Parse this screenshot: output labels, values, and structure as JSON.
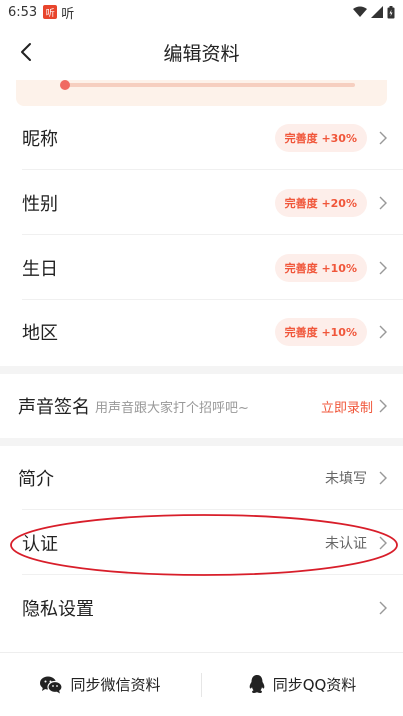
{
  "status_bar": {
    "time": "6:53",
    "app_icon_glyph": "听",
    "app_label": "听"
  },
  "header": {
    "title": "编辑资料"
  },
  "profile_completion": {
    "level": 0.0,
    "accent_color": "#f06a62"
  },
  "rows": [
    {
      "label": "昵称",
      "badge": "完善度 +30%"
    },
    {
      "label": "性别",
      "badge": "完善度 +20%"
    },
    {
      "label": "生日",
      "badge": "完善度 +10%"
    },
    {
      "label": "地区",
      "badge": "完善度 +10%"
    }
  ],
  "voice_signature": {
    "label": "声音签名",
    "hint": "用声音跟大家打个招呼吧~",
    "action": "立即录制"
  },
  "bio": {
    "label": "简介",
    "value": "未填写"
  },
  "verification": {
    "label": "认证",
    "value": "未认证"
  },
  "privacy": {
    "label": "隐私设置"
  },
  "bottom": {
    "sync_wechat": "同步微信资料",
    "sync_qq": "同步QQ资料"
  },
  "colors": {
    "accent": "#f0563a",
    "badge_bg": "#fdeeea",
    "highlight": "#d81e2a"
  }
}
